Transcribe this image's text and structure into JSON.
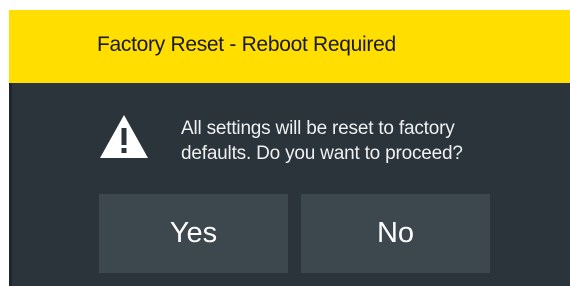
{
  "dialog": {
    "title": "Factory Reset - Reboot Required",
    "message_line1": "All settings will be reset to factory",
    "message_line2": "defaults. Do you want to proceed?",
    "icon": "warning-icon",
    "buttons": {
      "yes_label": "Yes",
      "no_label": "No"
    }
  },
  "colors": {
    "title_bar": "#ffde00",
    "body_background": "#2b343a",
    "button_background": "#3d474e",
    "text_light": "#eef0f1"
  }
}
